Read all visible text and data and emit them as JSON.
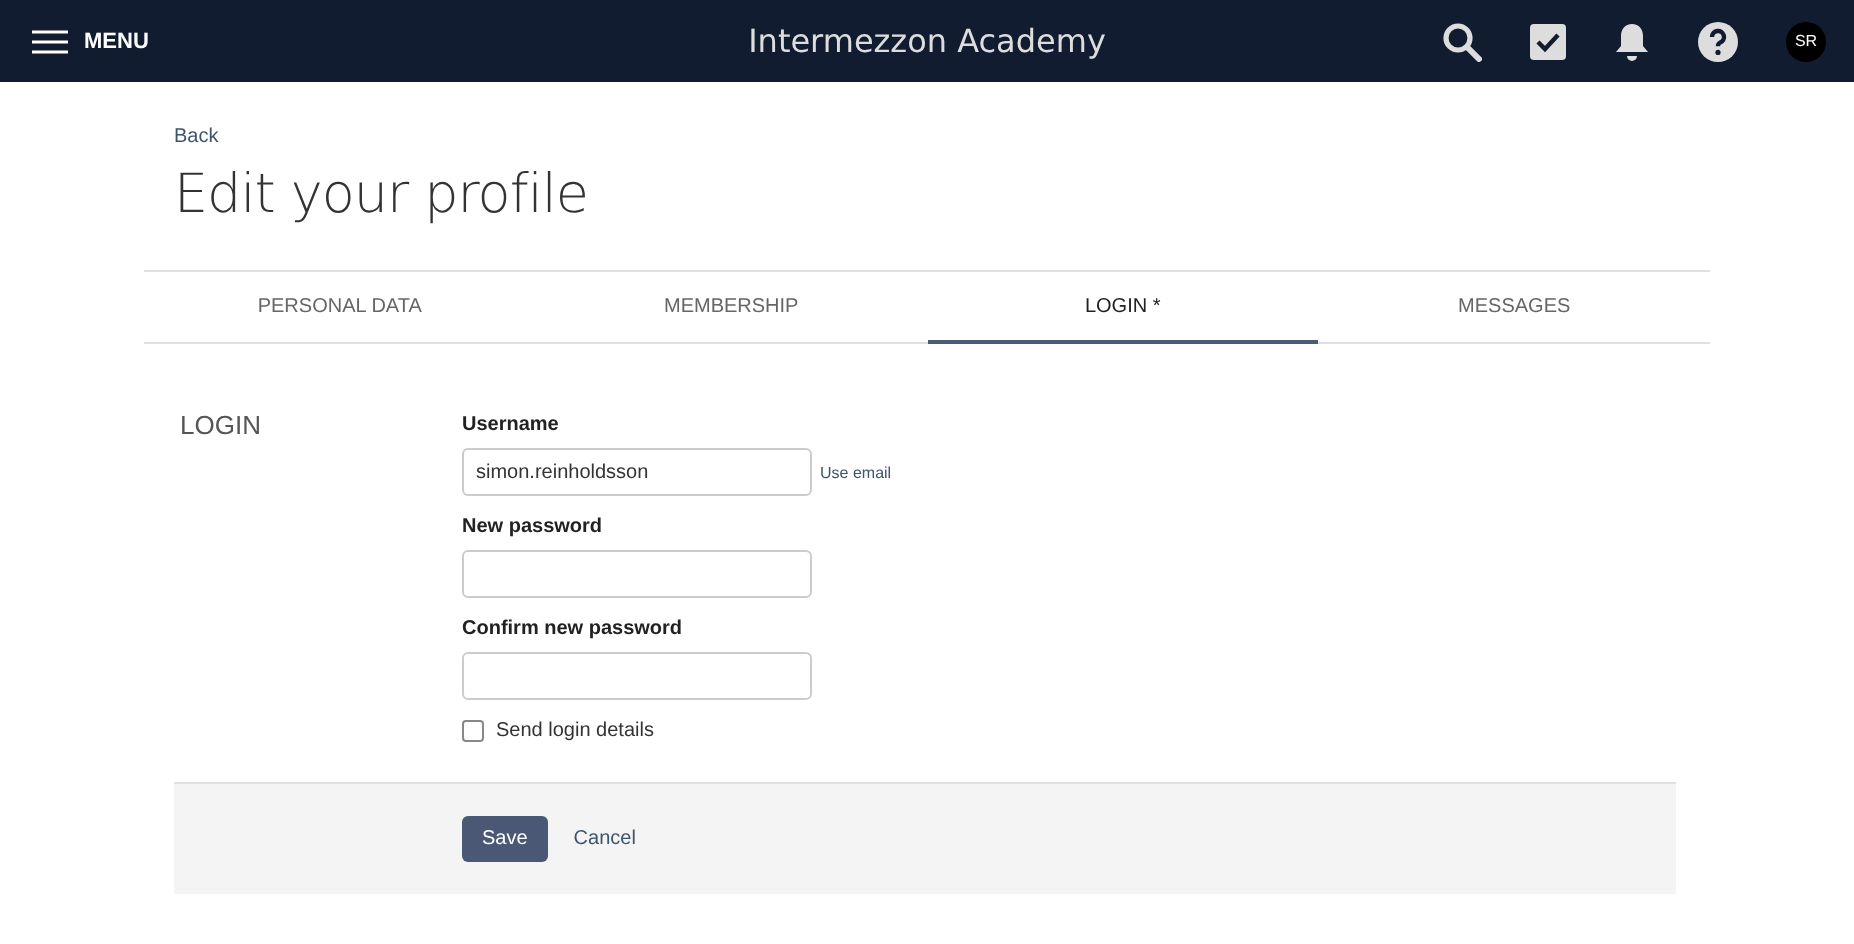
{
  "header": {
    "menu_label": "MENU",
    "title": "Intermezzon Academy",
    "avatar": "SR"
  },
  "back_link": "Back",
  "page_title": "Edit your profile",
  "tabs": [
    {
      "label": "PERSONAL DATA",
      "selected": false
    },
    {
      "label": "MEMBERSHIP",
      "selected": false
    },
    {
      "label": "LOGIN *",
      "selected": true
    },
    {
      "label": "MESSAGES",
      "selected": false
    }
  ],
  "section": {
    "title": "LOGIN",
    "fields": [
      {
        "kind": "text",
        "label": "Username",
        "value": "simon.reinholdsson",
        "link": "Use email"
      },
      {
        "kind": "text",
        "label": "New password"
      },
      {
        "kind": "text",
        "label": "Confirm new password"
      },
      {
        "kind": "checkbox",
        "label": "Send login details",
        "checked": false
      }
    ]
  },
  "buttons": [
    {
      "kind": "primary",
      "label": "Save"
    },
    {
      "kind": "link",
      "label": "Cancel"
    }
  ]
}
